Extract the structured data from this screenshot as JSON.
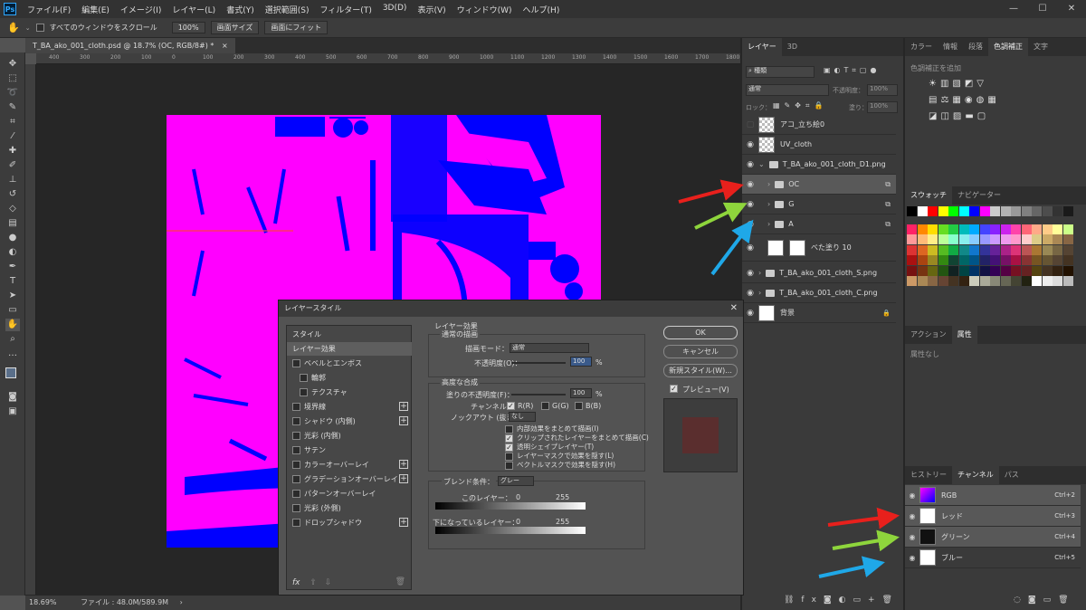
{
  "menu": [
    "ファイル(F)",
    "編集(E)",
    "イメージ(I)",
    "レイヤー(L)",
    "書式(Y)",
    "選択範囲(S)",
    "フィルター(T)",
    "3D(D)",
    "表示(V)",
    "ウィンドウ(W)",
    "ヘルプ(H)"
  ],
  "logo": "Ps",
  "window_controls": {
    "minimize": "—",
    "maximize": "☐",
    "close": "✕"
  },
  "options": {
    "scroll_all_label": "すべてのウィンドウをスクロール",
    "zoom": "100%",
    "fit_screen": "画面サイズ",
    "fill_screen": "画面にフィット"
  },
  "document": {
    "tab": "T_BA_ako_001_cloth.psd @ 18.7% (OC, RGB/8#) *",
    "close": "×",
    "zoom": "18.69%",
    "file_info": "ファイル : 48.0M/589.9M",
    "status_arrow": "›"
  },
  "ruler_ticks": [
    "400",
    "300",
    "200",
    "100",
    "0",
    "100",
    "200",
    "300",
    "400",
    "500",
    "600",
    "700",
    "800",
    "900",
    "1000",
    "1100",
    "1200",
    "1300",
    "1400",
    "1500",
    "1600",
    "1700",
    "1800"
  ],
  "layers_panel": {
    "tabs": [
      "レイヤー",
      "3D"
    ],
    "search_placeholder": "種類",
    "blend_mode": "通常",
    "opacity_label": "不透明度：",
    "opacity_value": "100%",
    "lock_label": "ロック：",
    "fill_label": "塗り：",
    "fill_value": "100%",
    "layers": [
      {
        "name": "アコ_立ち絵0",
        "type": "pixel",
        "visible": false
      },
      {
        "name": "UV_cloth",
        "type": "pixel",
        "visible": true
      },
      {
        "name": "T_BA_ako_001_cloth_D1.png",
        "type": "group-open",
        "visible": true
      },
      {
        "name": "OC",
        "type": "group",
        "visible": true,
        "selected": true
      },
      {
        "name": "G",
        "type": "group",
        "visible": true
      },
      {
        "name": "A",
        "type": "group",
        "visible": true
      },
      {
        "name": "べた塗り 10",
        "type": "fill",
        "visible": true
      },
      {
        "name": "T_BA_ako_001_cloth_S.png",
        "type": "group",
        "visible": true
      },
      {
        "name": "T_BA_ako_001_cloth_C.png",
        "type": "group",
        "visible": true
      },
      {
        "name": "背景",
        "type": "background",
        "visible": true
      }
    ]
  },
  "right_top": {
    "tabs": [
      "カラー",
      "情報",
      "段落",
      "色調補正",
      "文字"
    ],
    "active": "色調補正",
    "add_label": "色調補正を追加"
  },
  "swatches": {
    "tabs": [
      "スウォッチ",
      "ナビゲーター"
    ]
  },
  "props": {
    "tabs": [
      "アクション",
      "属性"
    ],
    "none_label": "属性なし"
  },
  "channels_panel": {
    "tabs": [
      "ヒストリー",
      "チャンネル",
      "パス"
    ],
    "channels": [
      {
        "name": "RGB",
        "shortcut": "Ctrl+2"
      },
      {
        "name": "レッド",
        "shortcut": "Ctrl+3"
      },
      {
        "name": "グリーン",
        "shortcut": "Ctrl+4"
      },
      {
        "name": "ブルー",
        "shortcut": "Ctrl+5"
      }
    ]
  },
  "dialog": {
    "title": "レイヤースタイル",
    "close": "✕",
    "style_header": "スタイル",
    "styles": [
      {
        "label": "レイヤー効果",
        "checkbox": false,
        "plus": false,
        "active": true
      },
      {
        "label": "ベベルとエンボス",
        "checkbox": true,
        "plus": false
      },
      {
        "label": "輪郭",
        "checkbox": true,
        "plus": false,
        "indent": true
      },
      {
        "label": "テクスチャ",
        "checkbox": true,
        "plus": false,
        "indent": true
      },
      {
        "label": "境界線",
        "checkbox": true,
        "plus": true
      },
      {
        "label": "シャドウ (内側)",
        "checkbox": true,
        "plus": true
      },
      {
        "label": "光彩 (内側)",
        "checkbox": true,
        "plus": false
      },
      {
        "label": "サテン",
        "checkbox": true,
        "plus": false
      },
      {
        "label": "カラーオーバーレイ",
        "checkbox": true,
        "plus": true
      },
      {
        "label": "グラデーションオーバーレイ",
        "checkbox": true,
        "plus": true
      },
      {
        "label": "パターンオーバーレイ",
        "checkbox": true,
        "plus": false
      },
      {
        "label": "光彩 (外側)",
        "checkbox": true,
        "plus": false
      },
      {
        "label": "ドロップシャドウ",
        "checkbox": true,
        "plus": true
      }
    ],
    "footer_fx": "fx",
    "layer_effects": "レイヤー効果",
    "general_blend": "通常の描画",
    "blend_mode_label": "描画モード：",
    "blend_mode_value": "通常",
    "opacity_label": "不透明度(O)：",
    "opacity_value": "100",
    "advanced": "高度な合成",
    "fill_opacity_label": "塗りの不透明度(F)：",
    "fill_opacity_value": "100",
    "percent": "%",
    "channels_label": "チャンネル：",
    "ch_r": "R(R)",
    "ch_g": "G(G)",
    "ch_b": "B(B)",
    "knockout_label": "ノックアウト (抜き)：",
    "knockout_value": "なし",
    "options": [
      {
        "label": "内部効果をまとめて描画(I)",
        "checked": false
      },
      {
        "label": "クリップされたレイヤーをまとめて描画(C)",
        "checked": true
      },
      {
        "label": "透明シェイプレイヤー(T)",
        "checked": true
      },
      {
        "label": "レイヤーマスクで効果を隠す(L)",
        "checked": false
      },
      {
        "label": "ベクトルマスクで効果を隠す(H)",
        "checked": false
      }
    ],
    "blend_if_label": "ブレンド条件：",
    "blend_if_value": "グレー",
    "this_layer": "このレイヤー：",
    "under_layer": "下になっているレイヤー：",
    "zero": "0",
    "max": "255",
    "ok": "OK",
    "cancel": "キャンセル",
    "new_style": "新規スタイル(W)...",
    "preview": "プレビュー(V)"
  },
  "colors": {
    "magenta": "#ff00ff",
    "blue": "#0000ff",
    "arrow_red": "#e8201c",
    "arrow_green": "#8ed53c",
    "arrow_blue": "#1fa8e8"
  }
}
